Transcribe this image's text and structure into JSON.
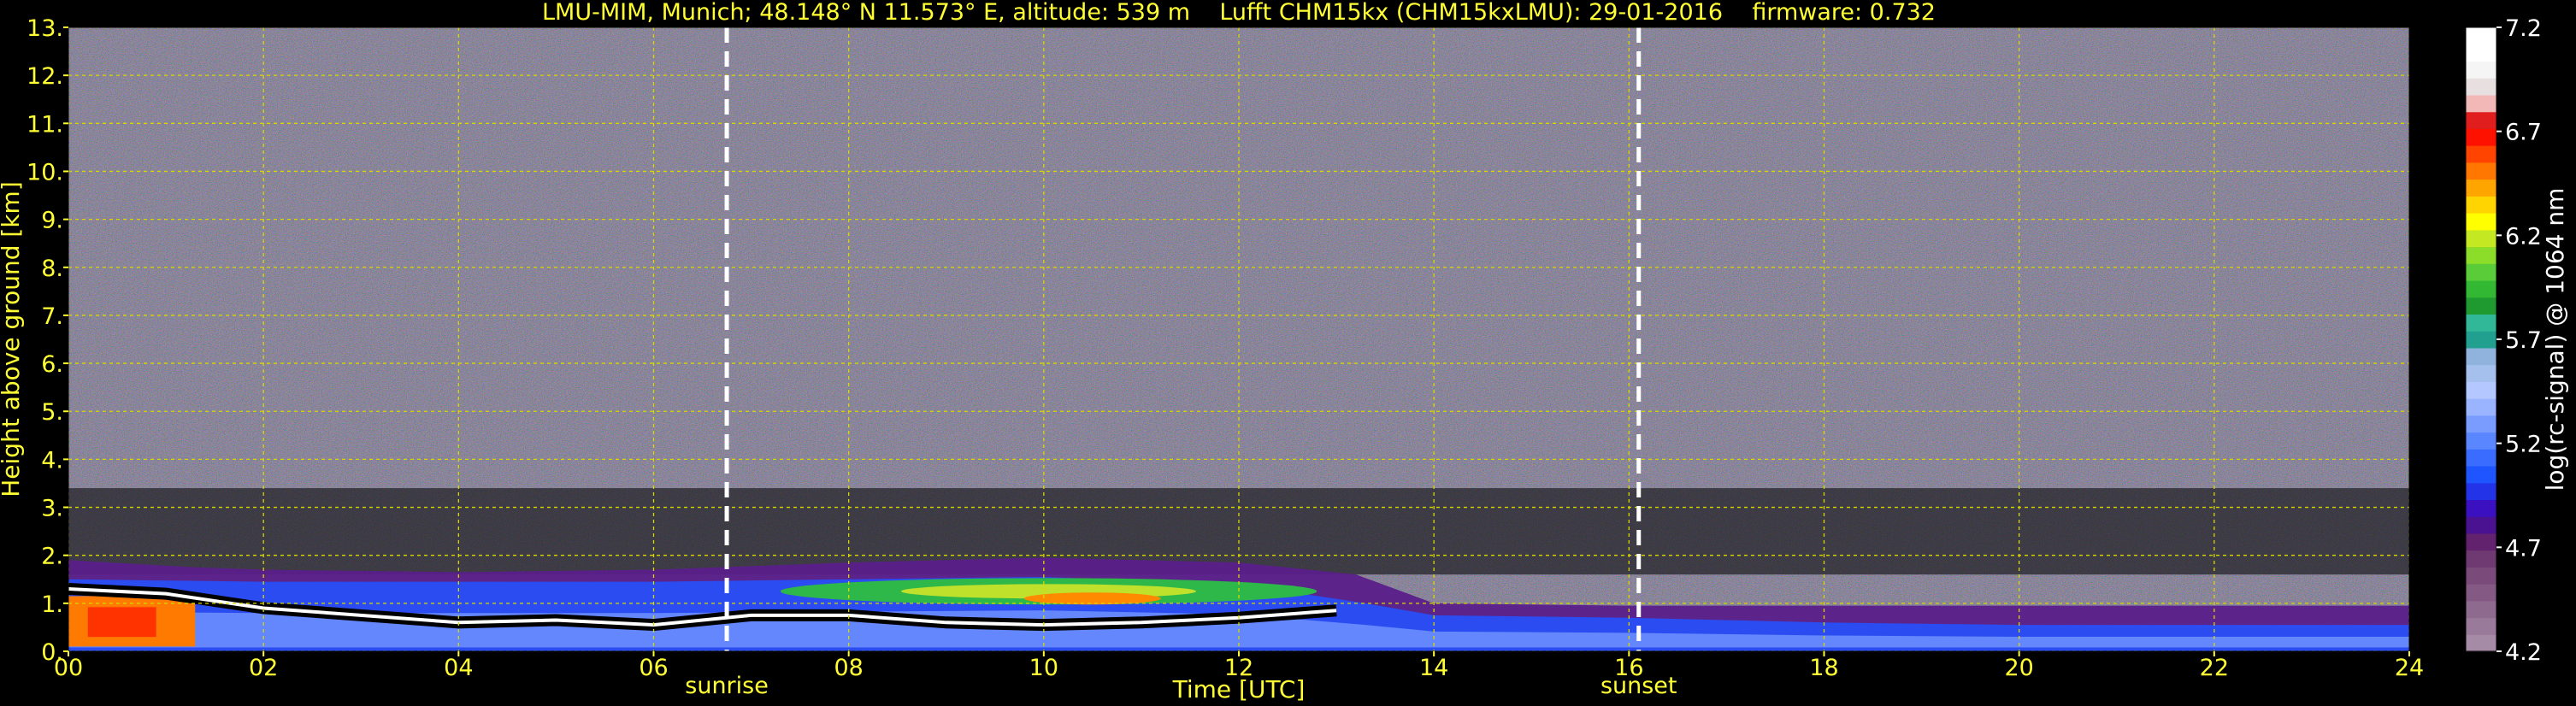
{
  "chart_data": {
    "type": "heatmap",
    "title": "LMU-MIM, Munich; 48.148° N 11.573° E, altitude: 539 m    Lufft CHM15kx (CHM15kxLMU): 29-01-2016    firmware: 0.732",
    "xlabel": "Time [UTC]",
    "ylabel": "Height above ground [km]",
    "xlim": [
      0,
      24
    ],
    "ylim": [
      0,
      13
    ],
    "x_ticks": [
      "00",
      "02",
      "04",
      "06",
      "08",
      "10",
      "12",
      "14",
      "16",
      "18",
      "20",
      "22",
      "24"
    ],
    "y_ticks": [
      "0.",
      "1.",
      "2.",
      "3.",
      "4.",
      "5.",
      "6.",
      "7.",
      "8.",
      "9.",
      "10.",
      "11.",
      "12.",
      "13."
    ],
    "grid": true,
    "colorbar": {
      "label": "log(rc-signal) @ 1064 nm",
      "range": [
        4.2,
        7.2
      ],
      "ticks": [
        "4.2",
        "4.7",
        "5.2",
        "5.7",
        "6.2",
        "6.7",
        "7.2"
      ],
      "colors": [
        "#a58ba5",
        "#9a7a9a",
        "#8f6a8f",
        "#845a84",
        "#7a4a7a",
        "#6f3a72",
        "#62226e",
        "#4a1290",
        "#3a10c0",
        "#2233e8",
        "#1e55ff",
        "#3a6cff",
        "#5a86ff",
        "#7a9cff",
        "#9ab4ff",
        "#b4c8ff",
        "#a6c0ee",
        "#8fb3dd",
        "#21a090",
        "#30b898",
        "#1e9a30",
        "#32b832",
        "#5acc3a",
        "#8cdd2a",
        "#c4e822",
        "#ffff00",
        "#ffd400",
        "#ffa500",
        "#ff7700",
        "#ff4400",
        "#ff1100",
        "#e01e1e",
        "#f2b8b8",
        "#e8e0e0",
        "#f5f5f5",
        "#ffffff",
        "#ffffff"
      ]
    },
    "markers": [
      {
        "label": "sunrise",
        "x": 6.75
      },
      {
        "label": "sunset",
        "x": 16.1
      }
    ],
    "colors": {
      "text": "#ffff33",
      "grid": "#d8d800",
      "background": "#000000",
      "noise": "#5a4a82"
    },
    "layers": [
      {
        "kind": "boundary_layer",
        "x": [
          0,
          1.3,
          2,
          4,
          6,
          8,
          10,
          12,
          13.2,
          14,
          16,
          18,
          20,
          22,
          24
        ],
        "top_km": [
          1.9,
          1.75,
          1.7,
          1.65,
          1.7,
          1.85,
          1.95,
          1.85,
          1.6,
          1.0,
          0.95,
          0.95,
          0.95,
          0.95,
          0.95
        ]
      },
      {
        "kind": "blue_aerosol",
        "x": [
          0,
          2,
          4,
          6,
          8,
          10,
          12,
          13.3,
          14,
          16,
          18,
          20,
          22,
          24
        ],
        "top_km": [
          1.5,
          1.45,
          1.45,
          1.45,
          1.5,
          1.55,
          1.4,
          1.0,
          0.75,
          0.7,
          0.6,
          0.55,
          0.55,
          0.55
        ]
      },
      {
        "kind": "green_band",
        "x_range": [
          7.3,
          12.8
        ],
        "center_km": 1.25,
        "thickness_km": 0.55,
        "peak_value": 6.3
      },
      {
        "kind": "orange_core",
        "x_range": [
          9.8,
          11.2
        ],
        "center_km": 1.1,
        "thickness_km": 0.25,
        "peak_value": 6.6
      },
      {
        "kind": "hot_surface_layer",
        "x_range": [
          0,
          1.3
        ],
        "top_km": 1.15,
        "peak_value": 7.2
      },
      {
        "kind": "black_inversion_line",
        "x": [
          0,
          1,
          2,
          4,
          5,
          6,
          7,
          8,
          9,
          10,
          11,
          12,
          13
        ],
        "height_km": [
          1.3,
          1.2,
          0.9,
          0.6,
          0.65,
          0.55,
          0.75,
          0.75,
          0.6,
          0.55,
          0.6,
          0.7,
          0.85
        ]
      }
    ]
  }
}
